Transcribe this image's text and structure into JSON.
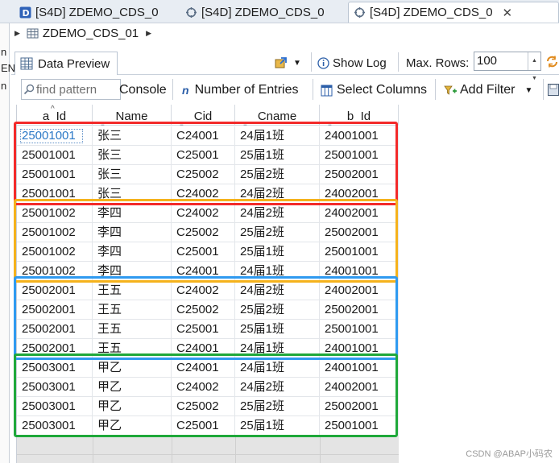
{
  "editor_tabs": [
    {
      "label": "[S4D] ZDEMO_CDS_0",
      "active": false
    },
    {
      "label": "[S4D] ZDEMO_CDS_0",
      "active": false
    },
    {
      "label": "[S4D] ZDEMO_CDS_0",
      "active": true
    }
  ],
  "left_panel_fragments": [
    "n",
    "EN",
    "n"
  ],
  "breadcrumb": {
    "label": "ZDEMO_CDS_01"
  },
  "view": {
    "tab_label": "Data Preview",
    "show_log_label": "Show Log",
    "max_rows_label": "Max. Rows:",
    "max_rows_value": "100"
  },
  "toolbar": {
    "search_placeholder": "find pattern",
    "console_label": "Console",
    "number_of_entries_label": "Number of Entries",
    "select_columns_label": "Select Columns",
    "add_filter_label": "Add Filter"
  },
  "table": {
    "columns": [
      "a_Id",
      "Name",
      "Cid",
      "Cname",
      "b_Id"
    ],
    "rows": [
      [
        "25001001",
        "张三",
        "C24001",
        "24届1班",
        "24001001"
      ],
      [
        "25001001",
        "张三",
        "C25001",
        "25届1班",
        "25001001"
      ],
      [
        "25001001",
        "张三",
        "C25002",
        "25届2班",
        "25002001"
      ],
      [
        "25001001",
        "张三",
        "C24002",
        "24届2班",
        "24002001"
      ],
      [
        "25001002",
        "李四",
        "C24002",
        "24届2班",
        "24002001"
      ],
      [
        "25001002",
        "李四",
        "C25002",
        "25届2班",
        "25002001"
      ],
      [
        "25001002",
        "李四",
        "C25001",
        "25届1班",
        "25001001"
      ],
      [
        "25001002",
        "李四",
        "C24001",
        "24届1班",
        "24001001"
      ],
      [
        "25002001",
        "王五",
        "C24002",
        "24届2班",
        "24002001"
      ],
      [
        "25002001",
        "王五",
        "C25002",
        "25届2班",
        "25002001"
      ],
      [
        "25002001",
        "王五",
        "C25001",
        "25届1班",
        "25001001"
      ],
      [
        "25002001",
        "王五",
        "C24001",
        "24届1班",
        "24001001"
      ],
      [
        "25003001",
        "甲乙",
        "C24001",
        "24届1班",
        "24001001"
      ],
      [
        "25003001",
        "甲乙",
        "C24002",
        "24届2班",
        "24002001"
      ],
      [
        "25003001",
        "甲乙",
        "C25002",
        "25届2班",
        "25002001"
      ],
      [
        "25003001",
        "甲乙",
        "C25001",
        "25届1班",
        "25001001"
      ]
    ]
  },
  "group_colors": [
    "#f32a2a",
    "#f5b21c",
    "#2f9af0",
    "#1fa83a"
  ],
  "watermark": "CSDN @ABAP小码农"
}
